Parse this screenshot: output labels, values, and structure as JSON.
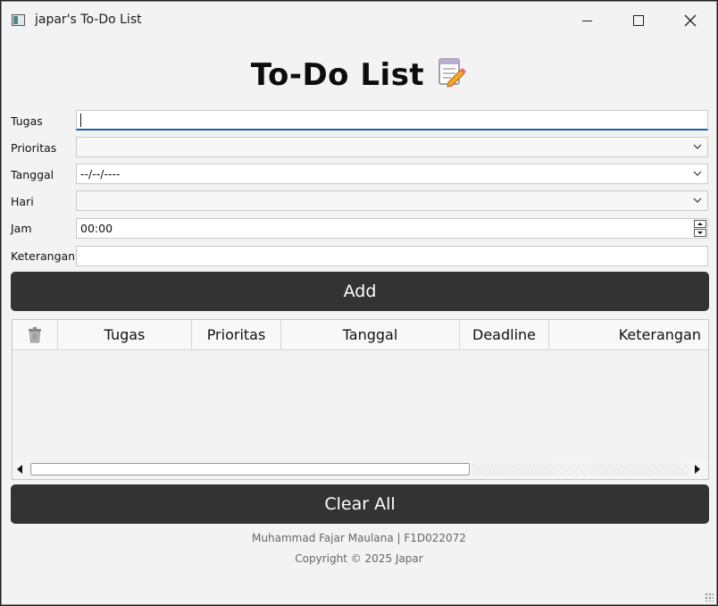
{
  "window": {
    "title": "japar's To-Do List"
  },
  "heading": {
    "text": "To-Do List"
  },
  "form": {
    "tugas": {
      "label": "Tugas",
      "value": ""
    },
    "prioritas": {
      "label": "Prioritas",
      "value": ""
    },
    "tanggal": {
      "label": "Tanggal",
      "value": "--/--/----"
    },
    "hari": {
      "label": "Hari",
      "value": ""
    },
    "jam": {
      "label": "Jam",
      "value": "00:00"
    },
    "keterangan": {
      "label": "Keterangan",
      "value": ""
    }
  },
  "buttons": {
    "add": "Add",
    "clear_all": "Clear All"
  },
  "table": {
    "columns": [
      "Tugas",
      "Prioritas",
      "Tanggal",
      "Deadline",
      "Keterangan"
    ],
    "rows": []
  },
  "footer": {
    "author": "Muhammad Fajar Maulana | F1D022072",
    "copyright": "Copyright © 2025 Japar"
  },
  "icons": {
    "app": "app-window-icon",
    "heading": "memo-pencil-icon",
    "delete_column": "trash-icon"
  }
}
